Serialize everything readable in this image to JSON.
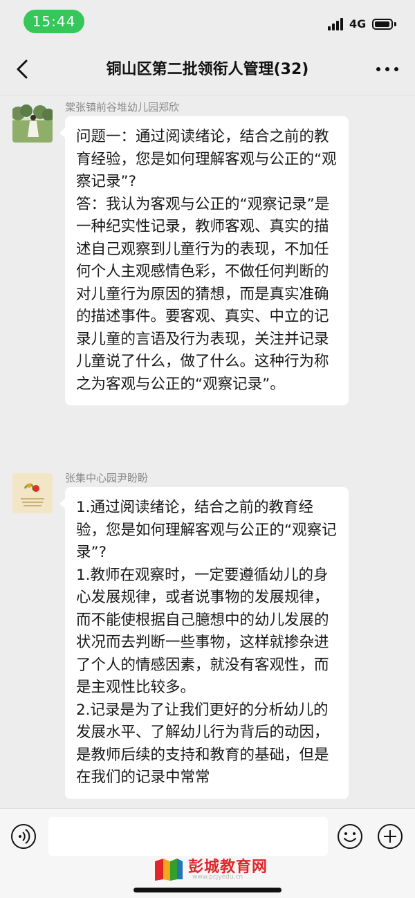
{
  "status_bar": {
    "time": "15:44",
    "network": "4G",
    "battery_level": 0.8
  },
  "nav": {
    "title": "铜山区第二批领衔人管理(32)"
  },
  "messages": [
    {
      "sender": "棠张镇前谷堆幼儿园郑欣",
      "lines": [
        "问题一：通过阅读绪论，结合之前的教育经验，您是如何理解客观与公正的“观察记录”?",
        "答：我认为客观与公正的“观察记录”是一种纪实性记录，教师客观、真实的描述自己观察到儿童行为的表现，不加任何个人主观感情色彩，不做任何判断的对儿童行为原因的猜想，而是真实准确的描述事件。要客观、真实、中立的记录儿童的言语及行为表现，关注并记录儿童说了什么，做了什么。这种行为称之为客观与公正的“观察记录”。"
      ]
    },
    {
      "sender": "张集中心园尹盼盼",
      "lines": [
        "1.通过阅读绪论，结合之前的教育经验，您是如何理解客观与公正的“观察记录”?",
        "1.教师在观察时，一定要遵循幼儿的身心发展规律，或者说事物的发展规律，而不能使根据自己臆想中的幼儿发展的状况而去判断一些事物，这样就掺杂进了个人的情感因素，就没有客观性，而是主观性比较多。",
        "2.记录是为了让我们更好的分析幼儿的发展水平、了解幼儿行为背后的动因，是教师后续的支持和教育的基础，但是在我们的记录中常常"
      ]
    }
  ],
  "input_bar": {
    "placeholder": ""
  },
  "watermark": {
    "text": "彭城教育网",
    "url": "www.pcjyedu.cn"
  }
}
